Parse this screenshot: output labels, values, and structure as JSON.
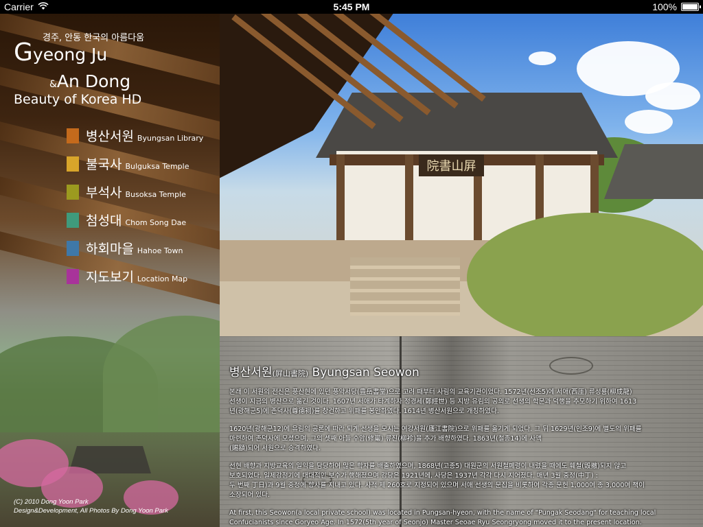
{
  "statusbar": {
    "carrier": "Carrier",
    "time": "5:45 PM",
    "battery": "100%"
  },
  "brand": {
    "korean_tagline": "경주, 안동 한국의 아름다움",
    "line1_initial": "G",
    "line1_rest": "yeong Ju",
    "line2_amp": "&",
    "line2": "An Dong",
    "line3": "Beauty of Korea HD"
  },
  "menu": {
    "items": [
      {
        "ko": "병산서원",
        "en": "Byungsan Library",
        "color": "#c46a1c"
      },
      {
        "ko": "불국사",
        "en": "Bulguksa Temple",
        "color": "#d8a52a"
      },
      {
        "ko": "부석사",
        "en": "Busoksa Temple",
        "color": "#9c9a1f"
      },
      {
        "ko": "첨성대",
        "en": "Chom Song Dae",
        "color": "#3f9a7c"
      },
      {
        "ko": "하회마을",
        "en": "Hahoe Town",
        "color": "#3f78a8"
      },
      {
        "ko": "지도보기",
        "en": "Location Map",
        "color": "#a8339a"
      }
    ]
  },
  "credits": {
    "line1": "(C) 2010 Dong Yoon Park",
    "line2": "Design&Development, All Photos By Dong Yoon Park"
  },
  "photo": {
    "signboard": "院書山屛"
  },
  "article": {
    "title_ko": "병산서원",
    "title_hanja": "(屛山書院)",
    "title_en": "Byungsan Seowon",
    "p1": [
      "본래 이 서원의 전신은 풍산현에 있던 풍악서당(豊岳書堂)으로 고려 때부터 사림의 교육기관이었다. 1572년(선조5)에 서애(西厓) 류성룡(柳成龍)",
      "선생이 지금의 병산으로 옮긴 것이다. 1607년 서애가 타계하자 정경세(鄭經世) 등 지방 유림의 공의로 선생의 학문과 덕행을 추모하기 위하여 1613",
      "년(광해군5)에 존덕사(尊德祠)를 창건하고 위패를 봉안하였다. 1614년 병산서원으로 개칭하였다."
    ],
    "p2": [
      "1620년(광해군12)에 유림의 공론에 따라 퇴계 선생을 모시는 여강서원(廬江書院)으로 위패를 옮기게 되었다. 그 뒤 1629년(인조9)에 별도의 위패를",
      "마련하여 존덕사에 모셨으며, 그의 셋째 아들 수암(修巖) 류진(柳袗)을 추가 배향하였다. 1863년(철종14)에 사액",
      "(賜額)되어 서원으로 승격하였다."
    ],
    "p3": [
      "선현 배향과 지방교육의 일익을 담당하여 많은 학자를 배출하였으며, 1868년(고종5) 대원군의 서원철폐령이 내렸을 때에도 훼철(毁撤)되지 않고",
      "보호되었다. 일제강점기에 대대적인 보수가 행해졌으며 강당은 1921년에, 사당은 1937년 각각 다시 지어졌다. 매년 3월 중정(中丁) :",
      "두 번째 丁日)과 9월 중정에 향사를 지내고 있다. 사적 제 260호로 지정되어 있으며 서애 선생의 문집을 비롯하여 각종 문헌 1,000여 종 3,000여 책이",
      "소장되어 있다."
    ],
    "p4": [
      "At first, this Seowon(a local private school) was located in Pungsan-hyeon, with the name of \"Pungak Seodang\" for teaching local",
      "Confucianists since Goryeo Age. In 1572(5th year of Seonjo) Master Seoae Ryu Seongryong moved it to the present location."
    ]
  }
}
